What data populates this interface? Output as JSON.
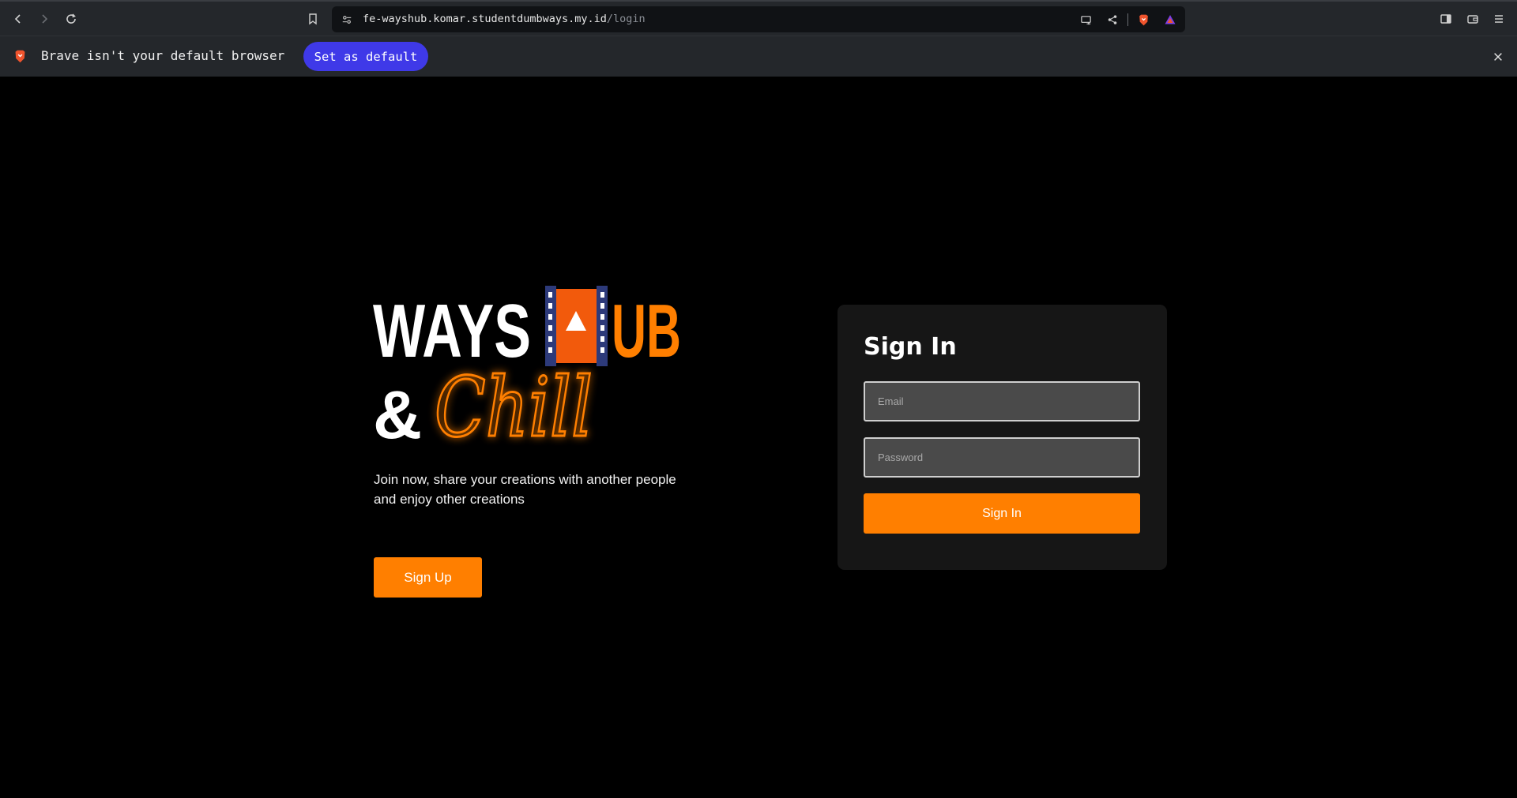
{
  "browser": {
    "url_host": "fe-wayshub.komar.studentdumbways.my.id",
    "url_path": "/login",
    "infobar_text": "Brave isn't your default browser",
    "set_default_label": "Set as default"
  },
  "logo": {
    "word_ways": "WAYS",
    "word_ub": "UB",
    "ampersand": "&",
    "script_word": "Chill",
    "colors": {
      "orange": "#ff7f00",
      "film_blue": "#2d3a7a",
      "film_orange": "#f25a0c"
    }
  },
  "hero": {
    "tagline": "Join now, share your creations with another people and enjoy other creations",
    "signup_label": "Sign Up"
  },
  "signin_card": {
    "title": "Sign In",
    "email_placeholder": "Email",
    "password_placeholder": "Password",
    "submit_label": "Sign In"
  },
  "theme": {
    "accent": "#ff7f00",
    "card_bg": "#161616",
    "brave_button": "#3f39e8"
  }
}
